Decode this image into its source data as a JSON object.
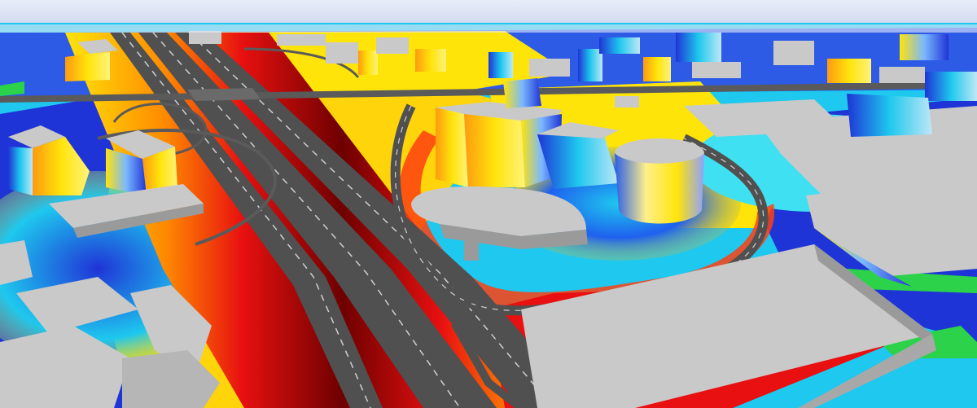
{
  "view": {
    "kind": "3d-noise-map",
    "colors": {
      "sky_top": "#e9edf8",
      "sky_bottom": "#c9d3ee",
      "ground_low": "#1f34d6",
      "ground_mid": "#1ec8ee",
      "ground_high": "#ffe40a",
      "ground_hot": "#ff6a00",
      "ground_peak": "#e01010",
      "ground_extreme": "#6e0000",
      "road": "#505050",
      "road_marking": "#cfcfcf",
      "building_roof": "#c9c9c9",
      "building_wall": "#9a9a9a",
      "grass": "#2bd24a"
    }
  }
}
